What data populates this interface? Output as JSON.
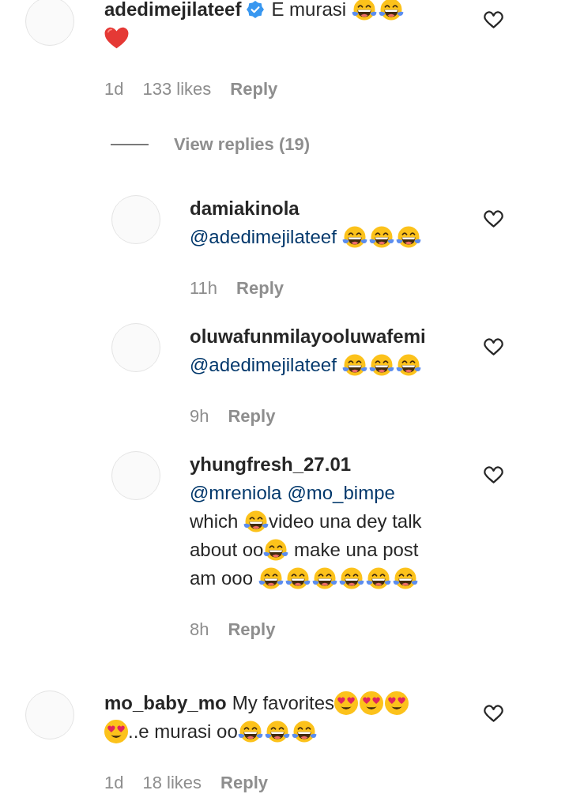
{
  "comments": [
    {
      "lines": [
        [
          {
            "kind": "user",
            "text": "adedimejilateef"
          },
          {
            "kind": "verified"
          },
          {
            "kind": "text",
            "text": "E murasi "
          },
          {
            "kind": "laugh"
          },
          {
            "kind": "laugh"
          }
        ],
        [
          {
            "kind": "heart"
          }
        ]
      ],
      "time": "1d",
      "likes": "133 likes",
      "reply": "Reply",
      "liked": false,
      "view_replies": {
        "label": "View replies (19)"
      },
      "replies": [
        {
          "lines": [
            [
              {
                "kind": "user",
                "text": "damiakinola"
              }
            ],
            [
              {
                "kind": "mention",
                "text": "@adedimejilateef"
              },
              {
                "kind": "laugh"
              },
              {
                "kind": "laugh"
              },
              {
                "kind": "laugh"
              }
            ]
          ],
          "time": "11h",
          "reply": "Reply",
          "liked": false
        },
        {
          "lines": [
            [
              {
                "kind": "user",
                "text": "oluwafunmilayooluwafemi"
              }
            ],
            [
              {
                "kind": "mention",
                "text": "@adedimejilateef"
              },
              {
                "kind": "laugh"
              },
              {
                "kind": "laugh"
              },
              {
                "kind": "laugh"
              }
            ]
          ],
          "time": "9h",
          "reply": "Reply",
          "liked": false
        },
        {
          "lines": [
            [
              {
                "kind": "user",
                "text": "yhungfresh_27.01"
              }
            ],
            [
              {
                "kind": "mention",
                "text": "@mreniola"
              },
              {
                "kind": "mention",
                "text": "@mo_bimpe"
              }
            ],
            [
              {
                "kind": "text",
                "text": "which "
              },
              {
                "kind": "laugh"
              },
              {
                "kind": "text",
                "text": "video una dey talk"
              }
            ],
            [
              {
                "kind": "text",
                "text": "about oo"
              },
              {
                "kind": "laugh"
              },
              {
                "kind": "text",
                "text": " make una post"
              }
            ],
            [
              {
                "kind": "text",
                "text": "am ooo "
              },
              {
                "kind": "laugh"
              },
              {
                "kind": "laugh"
              },
              {
                "kind": "laugh"
              },
              {
                "kind": "laugh"
              },
              {
                "kind": "laugh"
              },
              {
                "kind": "laugh"
              }
            ]
          ],
          "time": "8h",
          "reply": "Reply",
          "liked": false
        }
      ]
    },
    {
      "lines": [
        [
          {
            "kind": "user",
            "text": "mo_baby_mo"
          },
          {
            "kind": "text",
            "text": "My favorites"
          },
          {
            "kind": "hearteyes"
          },
          {
            "kind": "hearteyes"
          },
          {
            "kind": "hearteyes"
          }
        ],
        [
          {
            "kind": "hearteyes"
          },
          {
            "kind": "text",
            "text": "..e murasi oo"
          },
          {
            "kind": "laugh"
          },
          {
            "kind": "laugh"
          },
          {
            "kind": "laugh"
          }
        ]
      ],
      "time": "1d",
      "likes": "18 likes",
      "reply": "Reply",
      "liked": false
    }
  ]
}
